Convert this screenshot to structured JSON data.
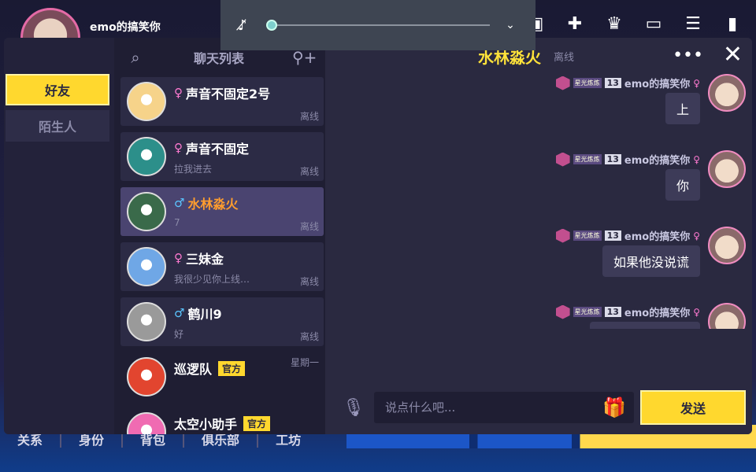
{
  "profile": {
    "name": "emo的搞笑你"
  },
  "top_icons": [
    "gamepad-icon",
    "add-user-icon",
    "rank-icon",
    "tv-icon",
    "menu-icon",
    "signal-icon"
  ],
  "bottom_nav": [
    "关系",
    "身份",
    "背包",
    "俱乐部",
    "工坊"
  ],
  "media": {
    "volume_level": 0
  },
  "tabs": [
    {
      "label": "好友",
      "active": true
    },
    {
      "label": "陌生人",
      "active": false
    }
  ],
  "friend_list": {
    "title": "聊天列表",
    "items": [
      {
        "name": "声音不固定2号",
        "gender": "♀",
        "gender_class": "f",
        "message": "",
        "status": "离线",
        "time": "",
        "official": "",
        "avatar_color": "#f6d38a",
        "name_class": "",
        "row_class": ""
      },
      {
        "name": "声音不固定",
        "gender": "♀",
        "gender_class": "f",
        "message": "拉我进去",
        "status": "离线",
        "time": "",
        "official": "",
        "avatar_color": "#2c8f8a",
        "name_class": "",
        "row_class": ""
      },
      {
        "name": "水林淼火",
        "gender": "♂",
        "gender_class": "m",
        "message": "7",
        "status": "离线",
        "time": "",
        "official": "",
        "avatar_color": "#3a6a4a",
        "name_class": "orange",
        "row_class": "selected"
      },
      {
        "name": "三妹金",
        "gender": "♀",
        "gender_class": "f",
        "message": "我很少见你上线…",
        "status": "离线",
        "time": "",
        "official": "",
        "avatar_color": "#6fa7e6",
        "name_class": "",
        "row_class": ""
      },
      {
        "name": "鹤川9",
        "gender": "♂",
        "gender_class": "m",
        "message": "好",
        "status": "离线",
        "time": "",
        "official": "",
        "avatar_color": "#9a9a9a",
        "name_class": "",
        "row_class": ""
      },
      {
        "name": "巡逻队",
        "gender": "",
        "gender_class": "",
        "message": "",
        "status": "",
        "time": "星期一",
        "official": "官方",
        "avatar_color": "#e2452f",
        "name_class": "",
        "row_class": "plain"
      },
      {
        "name": "太空小助手",
        "gender": "",
        "gender_class": "",
        "message": "",
        "status": "",
        "time": "",
        "official": "官方",
        "avatar_color": "#f06bb2",
        "name_class": "",
        "row_class": "plain"
      }
    ]
  },
  "chat": {
    "title": "水林淼火",
    "status": "离线",
    "messages": [
      {
        "sender": "emo的搞笑你",
        "badge": "星光炼炼",
        "level": "13",
        "gender": "♀",
        "text": "上"
      },
      {
        "sender": "emo的搞笑你",
        "badge": "星光炼炼",
        "level": "13",
        "gender": "♀",
        "text": "你"
      },
      {
        "sender": "emo的搞笑你",
        "badge": "星光炼炼",
        "level": "13",
        "gender": "♀",
        "text": "如果他没说谎"
      },
      {
        "sender": "emo的搞笑你",
        "badge": "星光炼炼",
        "level": "13",
        "gender": "♀",
        "text": ""
      }
    ],
    "input_placeholder": "说点什么吧...",
    "send_label": "发送"
  }
}
